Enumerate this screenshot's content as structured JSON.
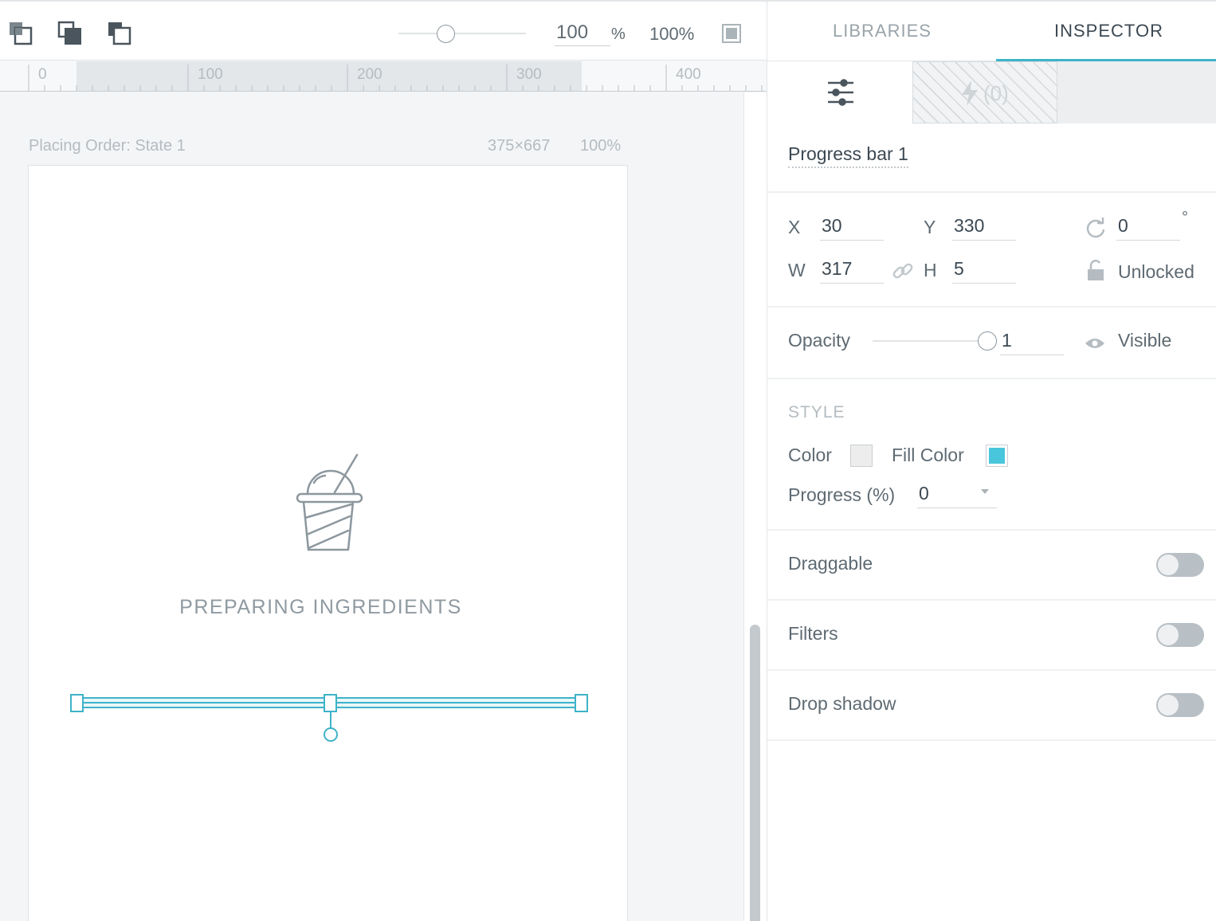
{
  "toolbar": {
    "icons": [
      "bring-forward-icon",
      "bring-to-front-icon",
      "send-backward-icon"
    ],
    "zoom_value": "100",
    "zoom_unit": "%",
    "zoom_fit_label": "100%",
    "zoom_slider_level": 0.35
  },
  "ruler": {
    "labels": [
      "0",
      "100",
      "200",
      "300",
      "400"
    ]
  },
  "canvas": {
    "state_name": "Placing Order: State 1",
    "state_size": "375×667",
    "state_zoom": "100%",
    "preparing_text": "PREPARING INGREDIENTS",
    "cup_icon": "drink-cup-icon",
    "selection_color": "#3eb3c8"
  },
  "panel": {
    "tabs": {
      "libraries": "LIBRARIES",
      "inspector": "INSPECTOR",
      "active": "INSPECTOR"
    },
    "subtabs": {
      "properties_icon": "sliders-icon",
      "interactions_icon": "lightning-icon",
      "interactions_count": "(0)"
    },
    "layer_name": "Progress bar 1",
    "geometry": {
      "x_label": "X",
      "x_value": "30",
      "y_label": "Y",
      "y_value": "330",
      "w_label": "W",
      "w_value": "317",
      "h_label": "H",
      "h_value": "5",
      "rotation_value": "0",
      "rotation_unit": "°",
      "lock_label": "Unlocked"
    },
    "opacity": {
      "label": "Opacity",
      "value": "1",
      "level": 1,
      "visibility_label": "Visible"
    },
    "style": {
      "heading": "STYLE",
      "color_label": "Color",
      "color_value": "#ededed",
      "fill_label": "Fill Color",
      "fill_value": "#49c6dc",
      "progress_label": "Progress (%)",
      "progress_value": "0"
    },
    "draggable_label": "Draggable",
    "filters_label": "Filters",
    "drop_shadow_label": "Drop shadow"
  }
}
